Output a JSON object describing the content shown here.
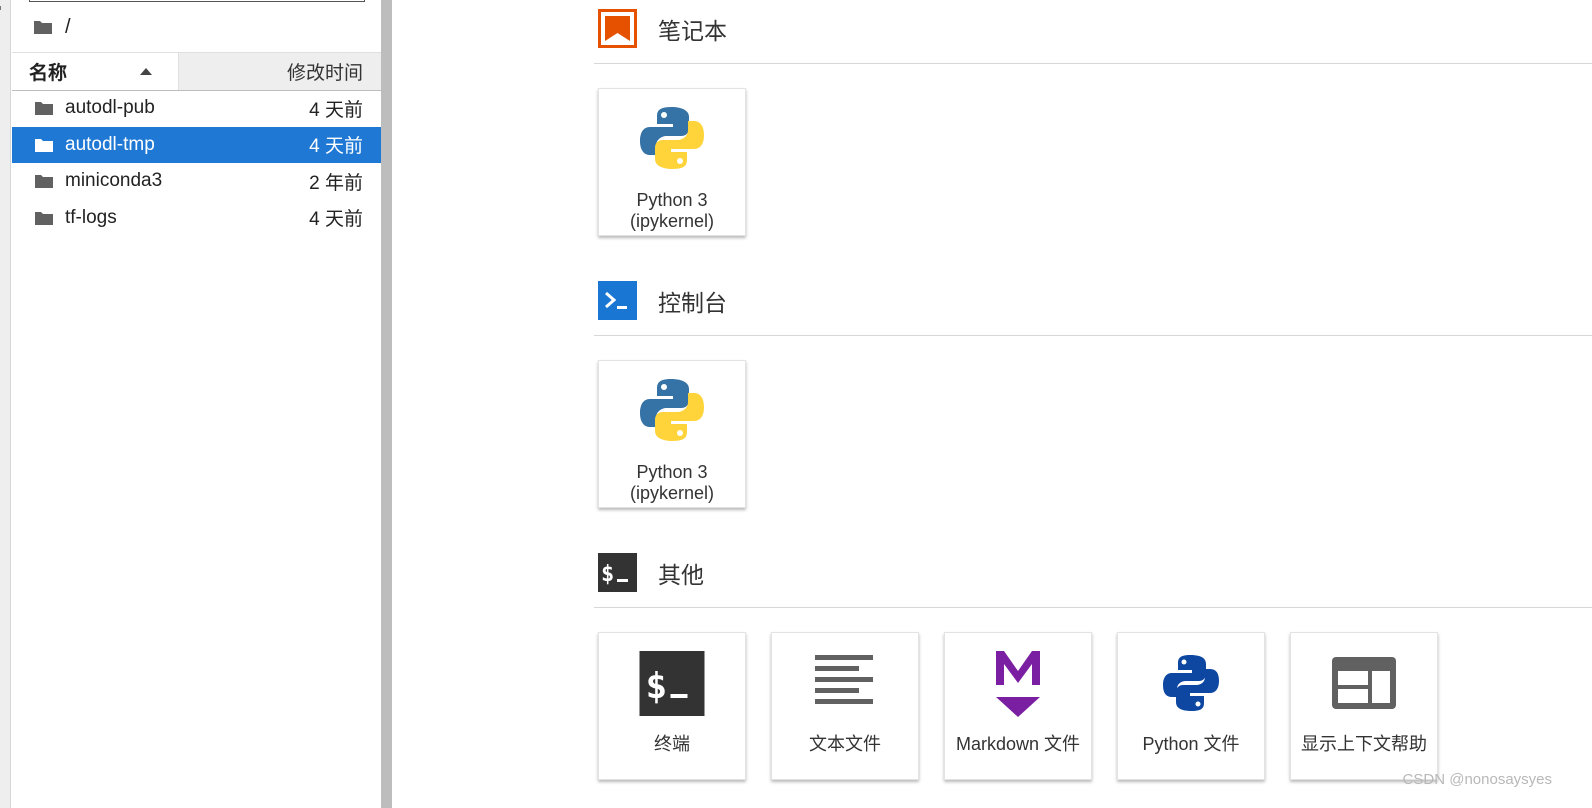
{
  "filebrowser": {
    "breadcrumb": "/",
    "columns": {
      "name": "名称",
      "modified": "修改时间"
    },
    "items": [
      {
        "name": "autodl-pub",
        "modified": "4 天前"
      },
      {
        "name": "autodl-tmp",
        "modified": "4 天前"
      },
      {
        "name": "miniconda3",
        "modified": "2 年前"
      },
      {
        "name": "tf-logs",
        "modified": "4 天前"
      }
    ]
  },
  "launcher": {
    "sections": [
      {
        "title": "笔记本",
        "icon": "notebook-icon",
        "color": "#e65100",
        "cards": [
          {
            "label1": "Python 3",
            "label2": "(ipykernel)",
            "icon": "python-logo-icon"
          }
        ]
      },
      {
        "title": "控制台",
        "icon": "console-icon",
        "color": "#1976d2",
        "cards": [
          {
            "label1": "Python 3",
            "label2": "(ipykernel)",
            "icon": "python-logo-icon"
          }
        ]
      },
      {
        "title": "其他",
        "icon": "other-terminal-icon",
        "color": "#333333",
        "cards": [
          {
            "label": "终端",
            "icon": "terminal-icon"
          },
          {
            "label": "文本文件",
            "icon": "text-file-icon"
          },
          {
            "label": "Markdown 文件",
            "icon": "markdown-icon"
          },
          {
            "label": "Python 文件",
            "icon": "python-file-icon"
          },
          {
            "label": "显示上下文帮助",
            "icon": "context-help-icon"
          }
        ]
      }
    ]
  },
  "watermark": "CSDN @nonosaysyes",
  "colors": {
    "selection": "#1e78d4",
    "markdown": "#7b1fa2",
    "python_blue": "#3572a5",
    "python_yellow": "#ffd43b"
  }
}
